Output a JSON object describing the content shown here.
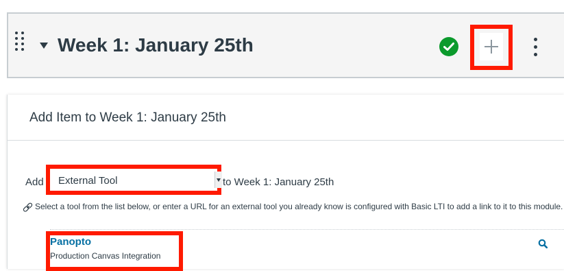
{
  "module": {
    "title": "Week 1: January 25th"
  },
  "dialog": {
    "title": "Add Item to Week 1: January 25th",
    "add_label": "Add",
    "item_type_selected": "External Tool",
    "to_label": "to Week 1: January 25th",
    "help_text": "Select a tool from the list below, or enter a URL for an external tool you already know is configured with Basic LTI to add a link to it to this module."
  },
  "tools": [
    {
      "name": "Panopto",
      "description": "Production Canvas Integration"
    }
  ],
  "icons": {
    "drag": "drag-handle-icon",
    "collapse": "caret-down-icon",
    "published": "check-circle-icon",
    "add": "plus-icon",
    "more": "kebab-menu-icon",
    "link": "link-icon",
    "search": "search-icon"
  },
  "colors": {
    "published": "#0b9a2c",
    "link": "#0770a3",
    "highlight": "#ff1a00",
    "text": "#2d3b45"
  }
}
